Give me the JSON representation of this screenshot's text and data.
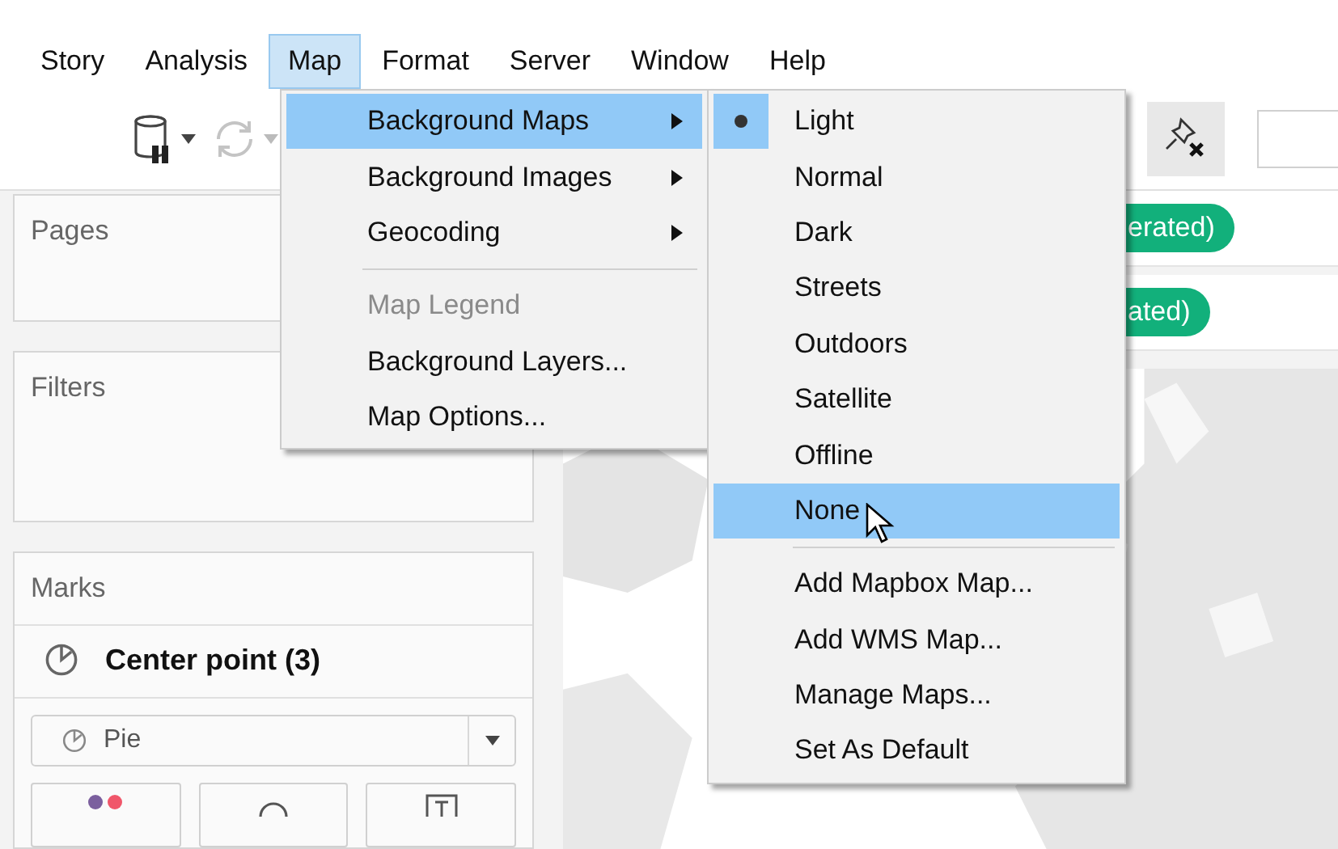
{
  "menubar": {
    "items": [
      {
        "label": "Story",
        "selected": false
      },
      {
        "label": "Analysis",
        "selected": false
      },
      {
        "label": "Map",
        "selected": true
      },
      {
        "label": "Format",
        "selected": false
      },
      {
        "label": "Server",
        "selected": false
      },
      {
        "label": "Window",
        "selected": false
      },
      {
        "label": "Help",
        "selected": false
      }
    ]
  },
  "map_menu": {
    "items": [
      {
        "kind": "submenu",
        "label": "Background Maps",
        "selected": true,
        "disabled": false
      },
      {
        "kind": "submenu",
        "label": "Background Images",
        "selected": false,
        "disabled": false
      },
      {
        "kind": "submenu",
        "label": "Geocoding",
        "selected": false,
        "disabled": false
      },
      {
        "kind": "separator"
      },
      {
        "kind": "command",
        "label": "Map Legend",
        "selected": false,
        "disabled": true
      },
      {
        "kind": "command",
        "label": "Background Layers...",
        "selected": false,
        "disabled": false
      },
      {
        "kind": "command",
        "label": "Map Options...",
        "selected": false,
        "disabled": false
      }
    ]
  },
  "background_maps_menu": {
    "items": [
      {
        "kind": "option",
        "label": "Light",
        "checked": true,
        "selected": false
      },
      {
        "kind": "option",
        "label": "Normal",
        "checked": false,
        "selected": false
      },
      {
        "kind": "option",
        "label": "Dark",
        "checked": false,
        "selected": false
      },
      {
        "kind": "option",
        "label": "Streets",
        "checked": false,
        "selected": false
      },
      {
        "kind": "option",
        "label": "Outdoors",
        "checked": false,
        "selected": false
      },
      {
        "kind": "option",
        "label": "Satellite",
        "checked": false,
        "selected": false
      },
      {
        "kind": "option",
        "label": "Offline",
        "checked": false,
        "selected": false
      },
      {
        "kind": "option",
        "label": "None",
        "checked": false,
        "selected": true
      },
      {
        "kind": "separator"
      },
      {
        "kind": "command",
        "label": "Add Mapbox Map...",
        "checked": false,
        "selected": false
      },
      {
        "kind": "command",
        "label": "Add WMS Map...",
        "checked": false,
        "selected": false
      },
      {
        "kind": "command",
        "label": "Manage Maps...",
        "checked": false,
        "selected": false
      },
      {
        "kind": "command",
        "label": "Set As Default",
        "checked": false,
        "selected": false
      }
    ]
  },
  "shelves": [
    {
      "pill": "erated)"
    },
    {
      "pill": "ated)"
    }
  ],
  "cards": {
    "pages": {
      "title": "Pages"
    },
    "filters": {
      "title": "Filters"
    },
    "marks": {
      "title": "Marks",
      "layer": "Center point (3)",
      "mark_type": "Pie"
    }
  }
}
